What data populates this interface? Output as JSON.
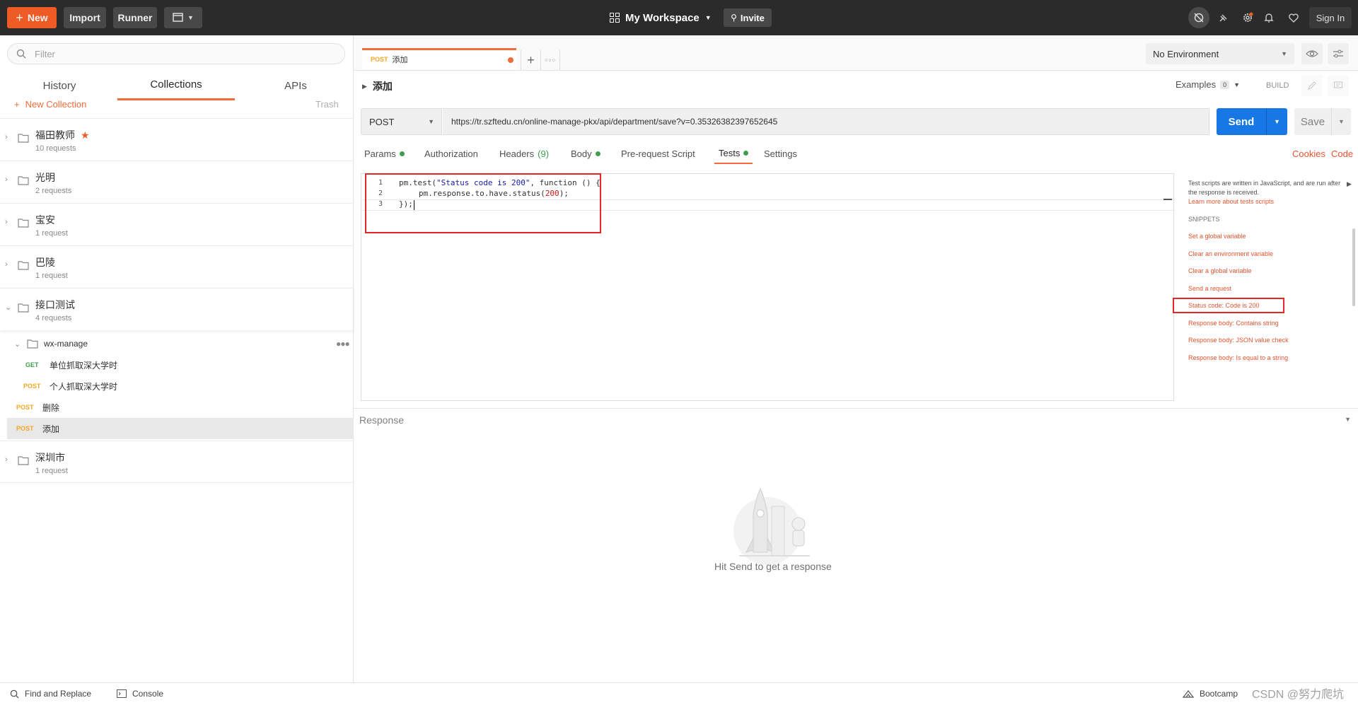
{
  "topbar": {
    "new_label": "New",
    "import_label": "Import",
    "runner_label": "Runner",
    "workspace_label": "My Workspace",
    "invite_label": "Invite",
    "signin_label": "Sign In"
  },
  "sidebar": {
    "filter_placeholder": "Filter",
    "tabs": [
      "History",
      "Collections",
      "APIs"
    ],
    "active_tab": "Collections",
    "new_collection_label": "New Collection",
    "trash_label": "Trash",
    "collections": [
      {
        "name": "福田教师",
        "count": "10 requests",
        "starred": true
      },
      {
        "name": "光明",
        "count": "2 requests"
      },
      {
        "name": "宝安",
        "count": "1 request"
      },
      {
        "name": "巴陵",
        "count": "1 request"
      },
      {
        "name": "接口测试",
        "count": "4 requests",
        "expanded": true
      }
    ],
    "folder_name": "wx-manage",
    "folder_requests": [
      {
        "method": "GET",
        "name": "单位抓取深大学时"
      },
      {
        "method": "POST",
        "name": "个人抓取深大学时"
      }
    ],
    "requests": [
      {
        "method": "POST",
        "name": "删除"
      },
      {
        "method": "POST",
        "name": "添加"
      }
    ],
    "last_collection": {
      "name": "深圳市",
      "count": "1 request"
    }
  },
  "request_tab": {
    "method": "POST",
    "name": "添加"
  },
  "environment": {
    "selected": "No Environment"
  },
  "request": {
    "title": "添加",
    "examples_label": "Examples",
    "examples_count": "0",
    "build_label": "BUILD",
    "method": "POST",
    "url": "https://tr.szftedu.cn/online-manage-pkx/api/department/save?v=0.35326382397652645",
    "send_label": "Send",
    "save_label": "Save"
  },
  "request_tabs": {
    "params": "Params",
    "authorization": "Authorization",
    "headers": "Headers",
    "headers_count": "(9)",
    "body": "Body",
    "prerequest": "Pre-request Script",
    "tests": "Tests",
    "settings": "Settings",
    "cookies": "Cookies",
    "code": "Code"
  },
  "editor": {
    "line_numbers": [
      "1",
      "2",
      "3"
    ],
    "line1_a": "pm.test(",
    "line1_str": "\"Status code is 200\"",
    "line1_b": ", function () {",
    "line2_a": "pm.response.to.have.status(",
    "line2_num": "200",
    "line2_b": ");",
    "line3": "});"
  },
  "help": {
    "text": "Test scripts are written in JavaScript, and are run after the response is received.",
    "learn_more": "Learn more about tests scripts",
    "snippets_heading": "SNIPPETS",
    "snippets": [
      "Set a global variable",
      "Clear an environment variable",
      "Clear a global variable",
      "Send a request",
      "Status code: Code is 200",
      "Response body: Contains string",
      "Response body: JSON value check",
      "Response body: Is equal to a string"
    ]
  },
  "response": {
    "title": "Response",
    "empty_message": "Hit Send to get a response"
  },
  "statusbar": {
    "find_replace": "Find and Replace",
    "console": "Console",
    "bootcamp": "Bootcamp",
    "watermark": "CSDN @努力爬坑"
  }
}
